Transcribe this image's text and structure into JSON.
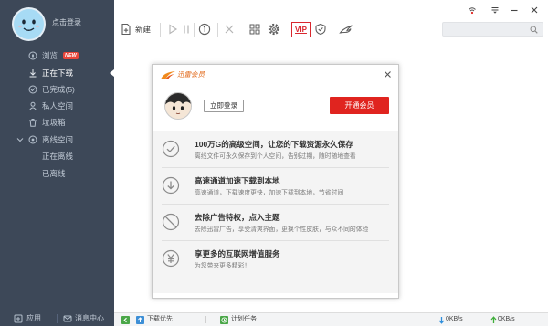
{
  "colors": {
    "sidebar_bg": "#3d4858",
    "vip_red": "#d9272e",
    "open_button_red": "#e0241f",
    "badge_red": "#e8463a",
    "brand_orange": "#f08a1c",
    "speed_down": "#2f8fdc",
    "speed_up": "#3fae3a"
  },
  "account": {
    "login_text": "点击登录",
    "avatar_icon": "smiley-avatar-icon"
  },
  "sidebar": {
    "items": [
      {
        "label": "浏览",
        "icon": "compass-icon",
        "badge": "NEW"
      },
      {
        "label": "正在下载",
        "icon": "download-icon",
        "selected": true
      },
      {
        "label": "已完成(5)",
        "icon": "check-circle-icon"
      },
      {
        "label": "私人空间",
        "icon": "person-icon"
      },
      {
        "label": "垃圾箱",
        "icon": "trash-icon"
      },
      {
        "label": "离线空间",
        "icon": "cloud-icon",
        "expanded": true
      }
    ],
    "sub_items": [
      {
        "label": "正在离线"
      },
      {
        "label": "已离线"
      }
    ],
    "footer": {
      "apps_label": "应用",
      "messages_label": "消息中心"
    }
  },
  "toolbar": {
    "new_label": "新建",
    "vip_label": "VIP",
    "icons": [
      "new-task-icon",
      "play-icon",
      "pause-icon",
      "info-icon",
      "delete-icon",
      "grid-icon",
      "gear-icon",
      "shield-icon",
      "bird-icon"
    ]
  },
  "window_controls": [
    "signal-icon",
    "menu-icon",
    "minimize-icon",
    "close-icon"
  ],
  "popup": {
    "brand": "迅雷会员",
    "login_button": "立即登录",
    "open_button": "开通会员",
    "features": [
      {
        "icon": "check-circle-icon",
        "title": "100万G的高级空间，让您的下载资源永久保存",
        "desc": "离线文件可永久保存到个人空间，告别过期，随时随地查看"
      },
      {
        "icon": "download-circle-icon",
        "title": "高速通道加速下载到本地",
        "desc": "高速通道，下载速度更快，加速下载到本地，节省时间"
      },
      {
        "icon": "no-ads-icon",
        "title": "去除广告特权，点入主题",
        "desc": "去除迅雷广告，享受清爽界面，更换个性皮肤，与众不同的体验"
      },
      {
        "icon": "yen-circle-icon",
        "title": "享更多的互联网增值服务",
        "desc": "为您带来更多精彩！"
      }
    ]
  },
  "status_bar": {
    "download_priority": "下载优先",
    "scheduled": "计划任务",
    "down_speed": "0KB/s",
    "up_speed": "0KB/s"
  }
}
